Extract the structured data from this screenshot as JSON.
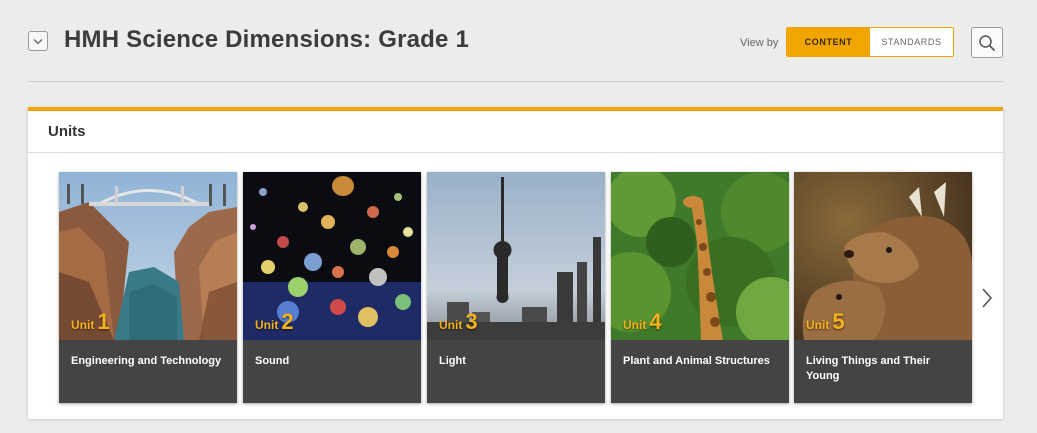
{
  "header": {
    "title": "HMH Science Dimensions: Grade 1",
    "view_by_label": "View by",
    "toggle": {
      "content": "CONTENT",
      "standards": "STANDARDS",
      "selected": "CONTENT"
    }
  },
  "icons": {
    "collapse": "chevron-down-icon",
    "search": "search-icon",
    "next": "chevron-right-icon"
  },
  "colors": {
    "accent": "#f0a500",
    "caption_bg": "#444444",
    "unit_label": "#f5b21a"
  },
  "units": {
    "title": "Units",
    "items": [
      {
        "unit_word": "Unit",
        "number": "1",
        "title": "Engineering and Technology"
      },
      {
        "unit_word": "Unit",
        "number": "2",
        "title": "Sound"
      },
      {
        "unit_word": "Unit",
        "number": "3",
        "title": "Light"
      },
      {
        "unit_word": "Unit",
        "number": "4",
        "title": "Plant and Animal Structures"
      },
      {
        "unit_word": "Unit",
        "number": "5",
        "title": "Living Things and Their Young"
      }
    ]
  }
}
